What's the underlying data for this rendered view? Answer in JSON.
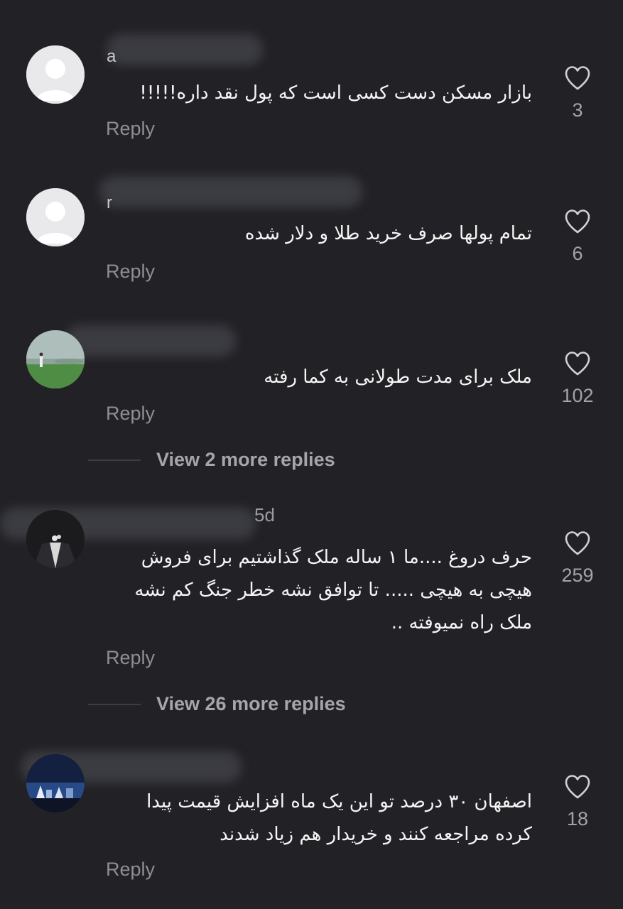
{
  "comments": [
    {
      "name_fragment": "a",
      "text": "بازار مسکن دست کسی است که پول نقد داره!!!!!",
      "reply_label": "Reply",
      "likes": "3",
      "avatar": "default-avatar"
    },
    {
      "name_fragment": "r",
      "text": "تمام پولها صرف خرید طلا و دلار  شده",
      "reply_label": "Reply",
      "likes": "6",
      "avatar": "default-avatar"
    },
    {
      "text": "ملک برای مدت طولانی به کما رفته",
      "reply_label": "Reply",
      "likes": "102",
      "avatar": "photo-avatar",
      "view_more": "View 2 more replies"
    },
    {
      "time_fragment": "5d",
      "text": "حرف دروغ ....ما ۱ ساله ملک گذاشتیم برای فروش هیچی به هیچی ..... تا توافق نشه خطر جنگ کم نشه ملک راه نمیوفته ..",
      "reply_label": "Reply",
      "likes": "259",
      "avatar": "photo-avatar",
      "view_more": "View 26 more replies"
    },
    {
      "text": "اصفهان ۳۰ درصد تو این یک ماه افزایش قیمت پیدا کرده مراجعه کنند و خریدار هم زیاد شدند",
      "reply_label": "Reply",
      "likes": "18",
      "avatar": "photo-avatar"
    }
  ],
  "icons": {
    "like": "heart-outline-icon"
  },
  "colors": {
    "background": "#222226",
    "text": "#f5f5f5",
    "secondary": "#8e8e95"
  }
}
